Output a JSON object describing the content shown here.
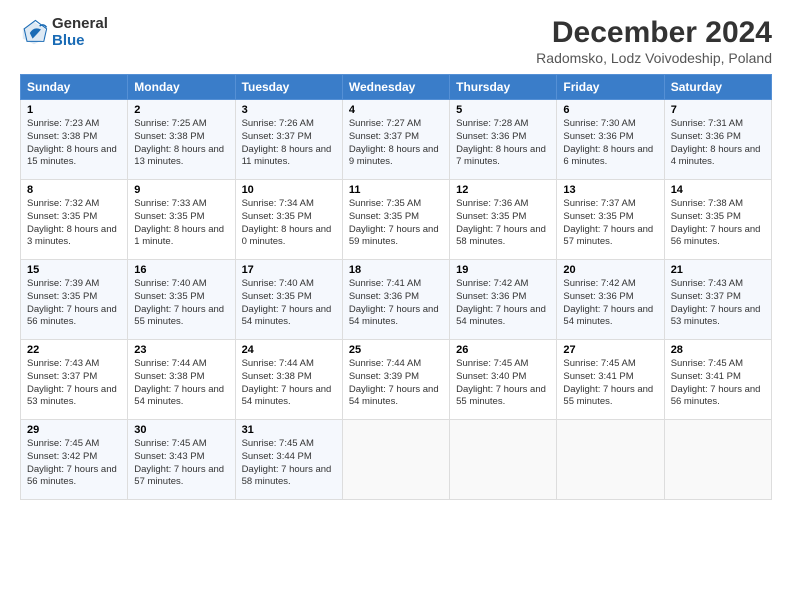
{
  "header": {
    "logo_line1": "General",
    "logo_line2": "Blue",
    "main_title": "December 2024",
    "subtitle": "Radomsko, Lodz Voivodeship, Poland"
  },
  "calendar": {
    "columns": [
      "Sunday",
      "Monday",
      "Tuesday",
      "Wednesday",
      "Thursday",
      "Friday",
      "Saturday"
    ],
    "weeks": [
      [
        {
          "day": "1",
          "content": "Sunrise: 7:23 AM\nSunset: 3:38 PM\nDaylight: 8 hours and 15 minutes."
        },
        {
          "day": "2",
          "content": "Sunrise: 7:25 AM\nSunset: 3:38 PM\nDaylight: 8 hours and 13 minutes."
        },
        {
          "day": "3",
          "content": "Sunrise: 7:26 AM\nSunset: 3:37 PM\nDaylight: 8 hours and 11 minutes."
        },
        {
          "day": "4",
          "content": "Sunrise: 7:27 AM\nSunset: 3:37 PM\nDaylight: 8 hours and 9 minutes."
        },
        {
          "day": "5",
          "content": "Sunrise: 7:28 AM\nSunset: 3:36 PM\nDaylight: 8 hours and 7 minutes."
        },
        {
          "day": "6",
          "content": "Sunrise: 7:30 AM\nSunset: 3:36 PM\nDaylight: 8 hours and 6 minutes."
        },
        {
          "day": "7",
          "content": "Sunrise: 7:31 AM\nSunset: 3:36 PM\nDaylight: 8 hours and 4 minutes."
        }
      ],
      [
        {
          "day": "8",
          "content": "Sunrise: 7:32 AM\nSunset: 3:35 PM\nDaylight: 8 hours and 3 minutes."
        },
        {
          "day": "9",
          "content": "Sunrise: 7:33 AM\nSunset: 3:35 PM\nDaylight: 8 hours and 1 minute."
        },
        {
          "day": "10",
          "content": "Sunrise: 7:34 AM\nSunset: 3:35 PM\nDaylight: 8 hours and 0 minutes."
        },
        {
          "day": "11",
          "content": "Sunrise: 7:35 AM\nSunset: 3:35 PM\nDaylight: 7 hours and 59 minutes."
        },
        {
          "day": "12",
          "content": "Sunrise: 7:36 AM\nSunset: 3:35 PM\nDaylight: 7 hours and 58 minutes."
        },
        {
          "day": "13",
          "content": "Sunrise: 7:37 AM\nSunset: 3:35 PM\nDaylight: 7 hours and 57 minutes."
        },
        {
          "day": "14",
          "content": "Sunrise: 7:38 AM\nSunset: 3:35 PM\nDaylight: 7 hours and 56 minutes."
        }
      ],
      [
        {
          "day": "15",
          "content": "Sunrise: 7:39 AM\nSunset: 3:35 PM\nDaylight: 7 hours and 56 minutes."
        },
        {
          "day": "16",
          "content": "Sunrise: 7:40 AM\nSunset: 3:35 PM\nDaylight: 7 hours and 55 minutes."
        },
        {
          "day": "17",
          "content": "Sunrise: 7:40 AM\nSunset: 3:35 PM\nDaylight: 7 hours and 54 minutes."
        },
        {
          "day": "18",
          "content": "Sunrise: 7:41 AM\nSunset: 3:36 PM\nDaylight: 7 hours and 54 minutes."
        },
        {
          "day": "19",
          "content": "Sunrise: 7:42 AM\nSunset: 3:36 PM\nDaylight: 7 hours and 54 minutes."
        },
        {
          "day": "20",
          "content": "Sunrise: 7:42 AM\nSunset: 3:36 PM\nDaylight: 7 hours and 54 minutes."
        },
        {
          "day": "21",
          "content": "Sunrise: 7:43 AM\nSunset: 3:37 PM\nDaylight: 7 hours and 53 minutes."
        }
      ],
      [
        {
          "day": "22",
          "content": "Sunrise: 7:43 AM\nSunset: 3:37 PM\nDaylight: 7 hours and 53 minutes."
        },
        {
          "day": "23",
          "content": "Sunrise: 7:44 AM\nSunset: 3:38 PM\nDaylight: 7 hours and 54 minutes."
        },
        {
          "day": "24",
          "content": "Sunrise: 7:44 AM\nSunset: 3:38 PM\nDaylight: 7 hours and 54 minutes."
        },
        {
          "day": "25",
          "content": "Sunrise: 7:44 AM\nSunset: 3:39 PM\nDaylight: 7 hours and 54 minutes."
        },
        {
          "day": "26",
          "content": "Sunrise: 7:45 AM\nSunset: 3:40 PM\nDaylight: 7 hours and 55 minutes."
        },
        {
          "day": "27",
          "content": "Sunrise: 7:45 AM\nSunset: 3:41 PM\nDaylight: 7 hours and 55 minutes."
        },
        {
          "day": "28",
          "content": "Sunrise: 7:45 AM\nSunset: 3:41 PM\nDaylight: 7 hours and 56 minutes."
        }
      ],
      [
        {
          "day": "29",
          "content": "Sunrise: 7:45 AM\nSunset: 3:42 PM\nDaylight: 7 hours and 56 minutes."
        },
        {
          "day": "30",
          "content": "Sunrise: 7:45 AM\nSunset: 3:43 PM\nDaylight: 7 hours and 57 minutes."
        },
        {
          "day": "31",
          "content": "Sunrise: 7:45 AM\nSunset: 3:44 PM\nDaylight: 7 hours and 58 minutes."
        },
        {
          "day": "",
          "content": ""
        },
        {
          "day": "",
          "content": ""
        },
        {
          "day": "",
          "content": ""
        },
        {
          "day": "",
          "content": ""
        }
      ]
    ]
  }
}
